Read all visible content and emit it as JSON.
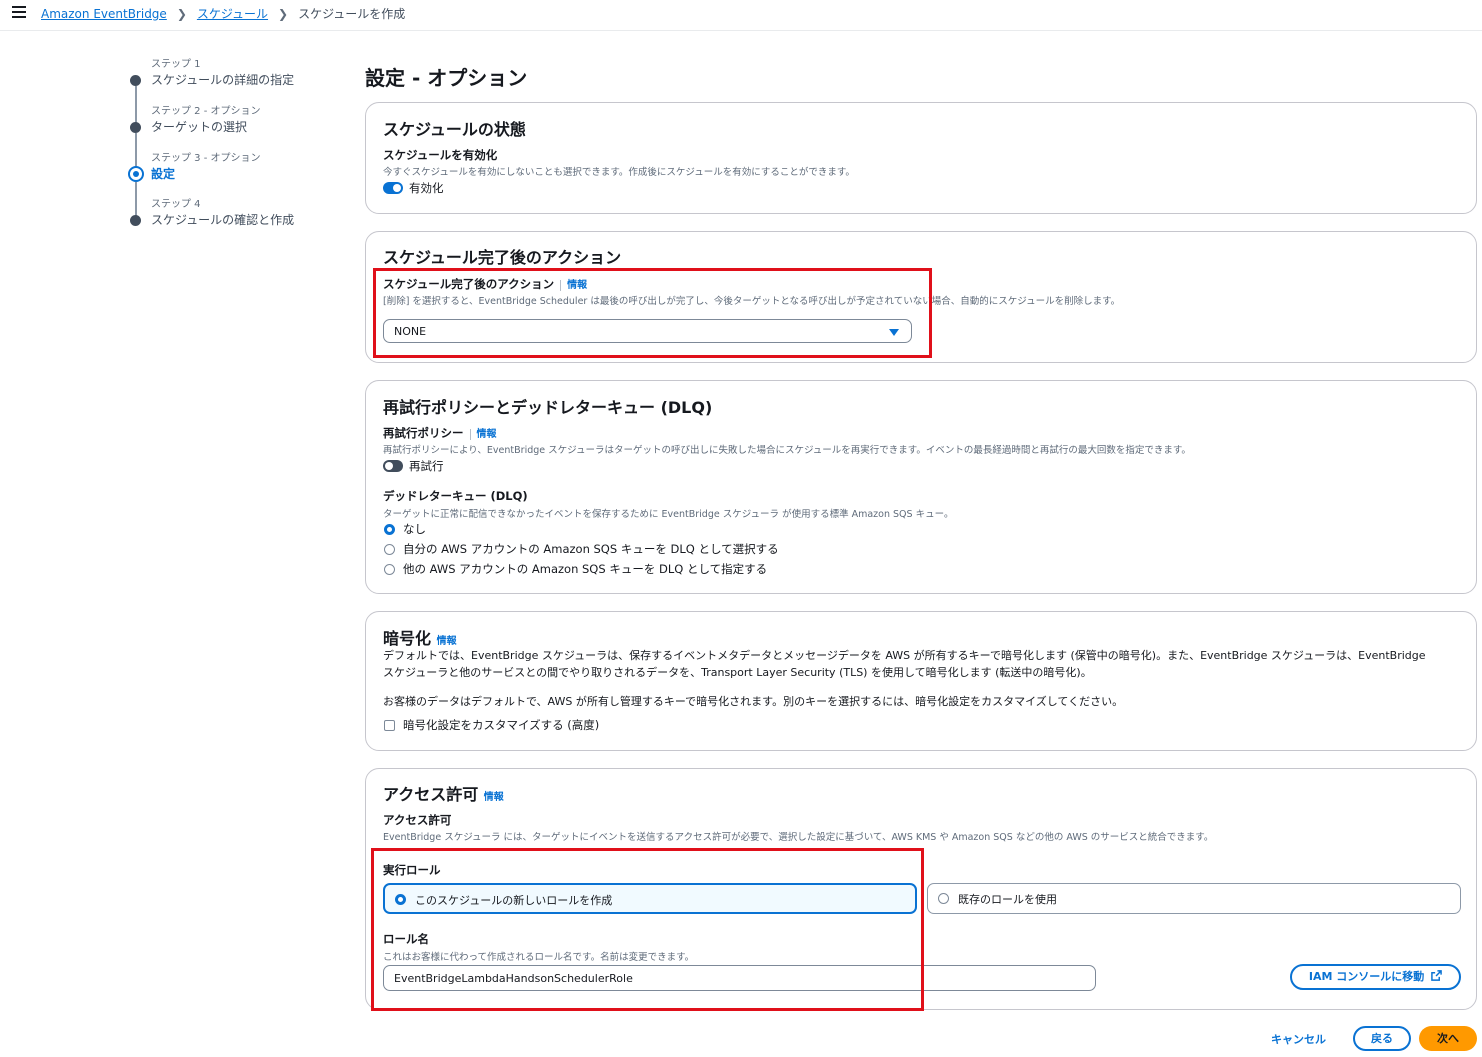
{
  "breadcrumbs": {
    "eventbridge": "Amazon EventBridge",
    "schedules": "スケジュール",
    "current": "スケジュールを作成"
  },
  "steps": [
    {
      "step_label": "ステップ 1",
      "name": "スケジュールの詳細の指定",
      "state": "done"
    },
    {
      "step_label": "ステップ 2 - オプション",
      "name": "ターゲットの選択",
      "state": "done"
    },
    {
      "step_label": "ステップ 3 - オプション",
      "name": "設定",
      "state": "current"
    },
    {
      "step_label": "ステップ 4",
      "name": "スケジュールの確認と作成",
      "state": "upcoming"
    }
  ],
  "page_title": "設定 - オプション",
  "schedule_state": {
    "title": "スケジュールの状態",
    "label": "スケジュールを有効化",
    "description": "今すぐスケジュールを有効にしないことも選択できます。作成後にスケジュールを有効にすることができます。",
    "toggle_label": "有効化",
    "enabled": true
  },
  "completion_action": {
    "title": "スケジュール完了後のアクション",
    "label": "スケジュール完了後のアクション",
    "info": "情報",
    "description": "[削除] を選択すると、EventBridge Scheduler は最後の呼び出しが完了し、今後ターゲットとなる呼び出しが予定されていない場合、自動的にスケジュールを削除します。",
    "selected": "NONE"
  },
  "retry": {
    "title": "再試行ポリシーとデッドレターキュー (DLQ)",
    "policy_label": "再試行ポリシー",
    "info": "情報",
    "policy_description": "再試行ポリシーにより、EventBridge スケジューラはターゲットの呼び出しに失敗した場合にスケジュールを再実行できます。イベントの最長経過時間と再試行の最大回数を指定できます。",
    "toggle_label": "再試行",
    "retry_enabled": false,
    "dlq_label": "デッドレターキュー (DLQ)",
    "dlq_description": "ターゲットに正常に配信できなかったイベントを保存するために EventBridge スケジューラ が使用する標準 Amazon SQS キュー。",
    "dlq_options": [
      "なし",
      "自分の AWS アカウントの Amazon SQS キューを DLQ として選択する",
      "他の AWS アカウントの Amazon SQS キューを DLQ として指定する"
    ],
    "dlq_selected_index": 0
  },
  "encryption": {
    "title": "暗号化",
    "info": "情報",
    "paragraph_line1": "デフォルトでは、EventBridge スケジューラは、保存するイベントメタデータとメッセージデータを AWS が所有するキーで暗号化します (保管中の暗号化)。また、EventBridge スケジューラは、EventBridge",
    "paragraph_line2": "スケジューラと他のサービスとの間でやり取りされるデータを、Transport Layer Security (TLS) を使用して暗号化します (転送中の暗号化)。",
    "paragraph2": "お客様のデータはデフォルトで、AWS が所有し管理するキーで暗号化されます。別のキーを選択するには、暗号化設定をカスタマイズしてください。",
    "checkbox_label": "暗号化設定をカスタマイズする (高度)",
    "customize_checked": false
  },
  "permissions": {
    "title": "アクセス許可",
    "info": "情報",
    "label": "アクセス許可",
    "description": "EventBridge スケジューラ には、ターゲットにイベントを送信するアクセス許可が必要で、選択した設定に基づいて、AWS KMS や Amazon SQS などの他の AWS のサービスと統合できます。",
    "exec_role_label": "実行ロール",
    "role_options": [
      "このスケジュールの新しいロールを作成",
      "既存のロールを使用"
    ],
    "role_selected_index": 0,
    "role_name_label": "ロール名",
    "role_name_description": "これはお客様に代わって作成されるロール名です。名前は変更できます。",
    "role_name_value": "EventBridgeLambdaHandsonSchedulerRole",
    "iam_button": "IAM コンソールに移動"
  },
  "footer": {
    "cancel": "キャンセル",
    "back": "戻る",
    "next": "次へ"
  },
  "colors": {
    "accent": "#0972d3",
    "primary_button": "#ff9900",
    "highlight_box": "#e0101a"
  }
}
